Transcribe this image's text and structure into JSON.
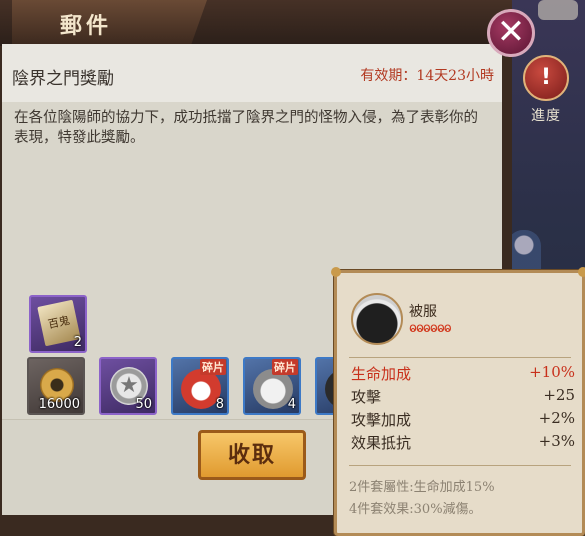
{
  "header": {
    "title": "郵件"
  },
  "advance": {
    "label": "進度",
    "icon": "advance-icon"
  },
  "mail": {
    "title": "陰界之門獎勵",
    "validity_label": "有效期：",
    "validity_value": "14天23小時",
    "body": "在各位陰陽師的協力下，成功抵擋了陰界之門的怪物入侵，為了表彰你的表現，特發此獎勵。"
  },
  "rewards": {
    "top_item": {
      "icon": "scroll-icon",
      "badge": "百鬼",
      "count": "2"
    },
    "items": [
      {
        "icon": "coin-icon",
        "count": "16000",
        "frame": "gray",
        "shard": ""
      },
      {
        "icon": "star-medal-icon",
        "count": "50",
        "frame": "gray",
        "shard": ""
      },
      {
        "icon": "daruma-red-icon",
        "count": "8",
        "frame": "blue",
        "shard": "碎片"
      },
      {
        "icon": "daruma-white-icon",
        "count": "4",
        "frame": "blue",
        "shard": "碎片"
      },
      {
        "icon": "daruma-dark-icon",
        "count": "",
        "frame": "blue",
        "shard": ""
      }
    ]
  },
  "collect_button": {
    "label": "收取"
  },
  "tooltip": {
    "name": "被服",
    "stars": "ⱺⱺⱺⱺⱺⱺ",
    "stats": [
      {
        "label": "生命加成",
        "value": "+10%",
        "highlight": true
      },
      {
        "label": "攻擊",
        "value": "+25",
        "highlight": false
      },
      {
        "label": "攻擊加成",
        "value": "+2%",
        "highlight": false
      },
      {
        "label": "效果抵抗",
        "value": "+3%",
        "highlight": false
      }
    ],
    "set2": "2件套屬性:生命加成15%",
    "set4": "4件套效果:30%減傷。"
  },
  "colors": {
    "highlight": "#c8301b",
    "validity": "#b23a22",
    "button": "#e09a2f"
  }
}
